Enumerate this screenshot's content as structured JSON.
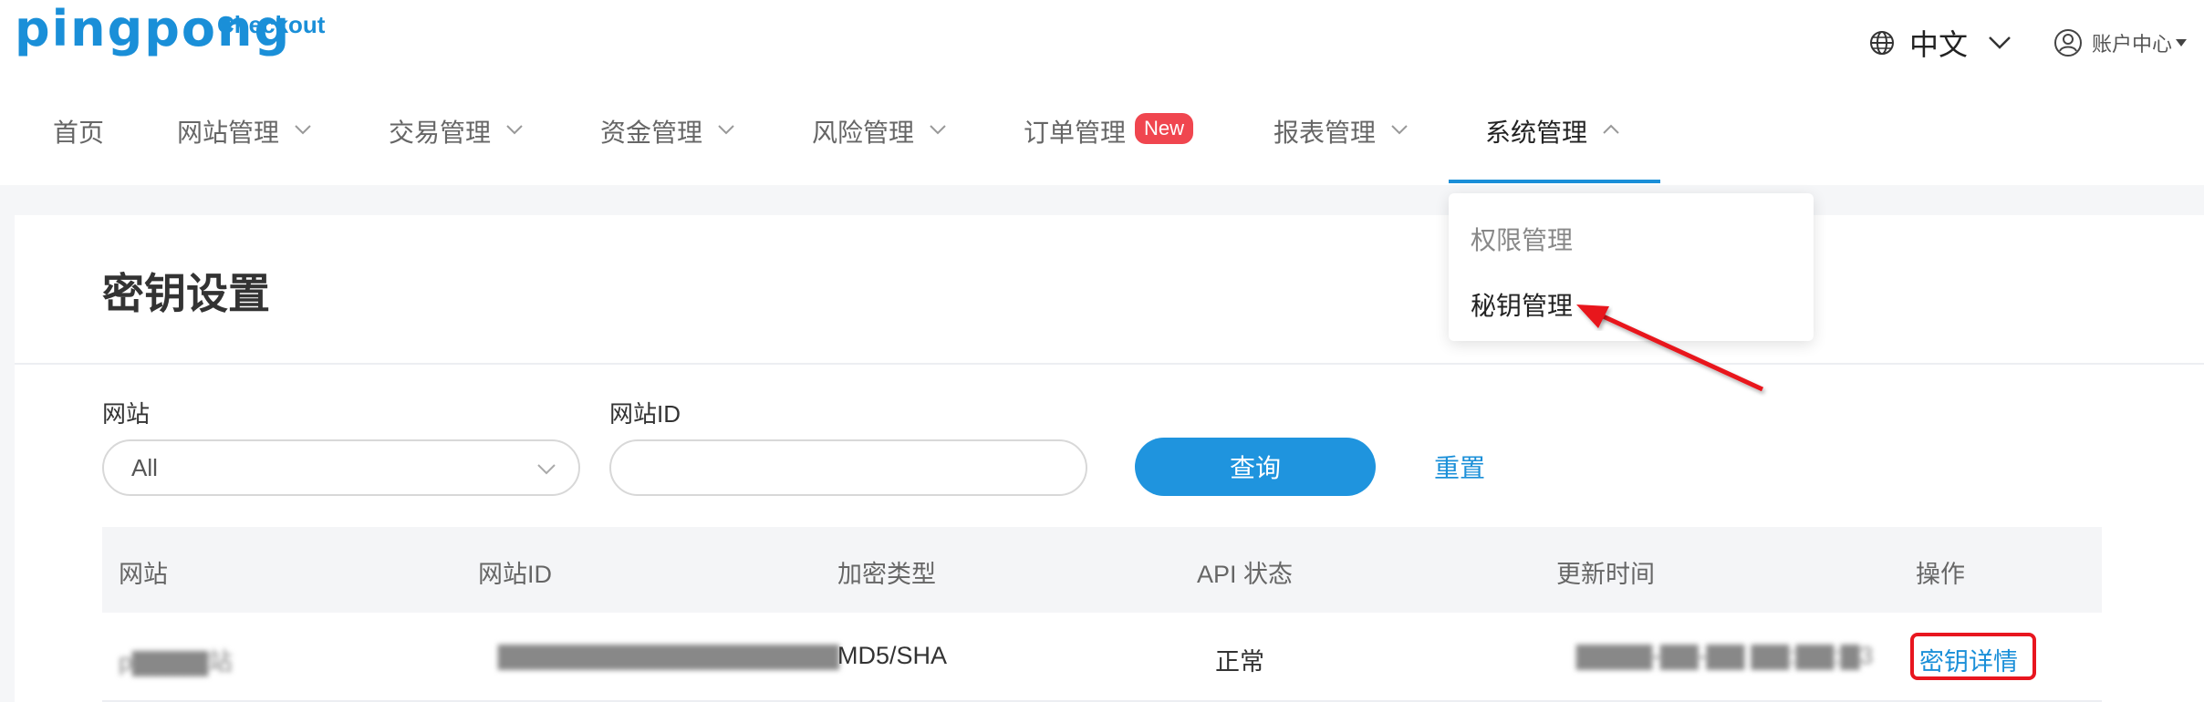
{
  "logo": {
    "main": "pingpong",
    "sub": "Checkout"
  },
  "header": {
    "language": "中文",
    "account": "账户中心",
    "icons": {
      "language": "globe-icon",
      "account": "user-icon"
    }
  },
  "nav": {
    "items": [
      {
        "label": "首页"
      },
      {
        "label": "网站管理"
      },
      {
        "label": "交易管理"
      },
      {
        "label": "资金管理"
      },
      {
        "label": "风险管理"
      },
      {
        "label": "订单管理",
        "badge": "New"
      },
      {
        "label": "报表管理"
      },
      {
        "label": "系统管理"
      }
    ],
    "active": "系统管理",
    "dropdown": [
      "权限管理",
      "秘钥管理"
    ]
  },
  "page": {
    "title": "密钥设置"
  },
  "filters": {
    "site_label": "网站",
    "site_value": "All",
    "site_id_label": "网站ID",
    "site_id_value": "",
    "query_button": "查询",
    "reset_button": "重置"
  },
  "table": {
    "columns": [
      "网站",
      "网站ID",
      "加密类型",
      "API 状态",
      "更新时间",
      "操作"
    ],
    "rows": [
      {
        "site": "p▇▇▇▇站",
        "site_id": "▇▇▇▇▇▇▇▇▇▇▇▇▇▇▇▇▇▇",
        "encryption": "MD5/SHA",
        "api_status": "正常",
        "updated": "▇▇▇▇-▇▇-▇▇ ▇▇:▇▇:▇3",
        "action": "密钥详情"
      }
    ]
  },
  "colors": {
    "accent": "#1a8fd8",
    "badge": "#f0464f",
    "annotation": "#e8161f"
  }
}
